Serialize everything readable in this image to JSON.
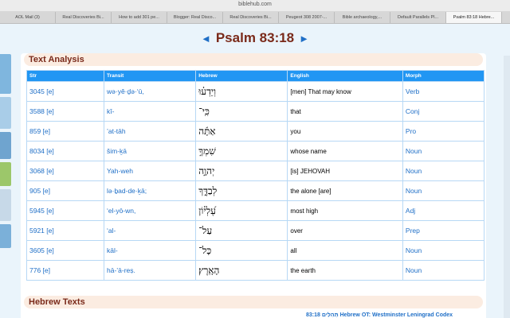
{
  "browser": {
    "url": "biblehub.com",
    "tabs": [
      "AOL Mail (3)",
      "Real Discoveries Bi...",
      "How to add 301 pe...",
      "Blogger: Real Disco...",
      "Real Discoveries Bi...",
      "Peugeot 308 2007-...",
      "Bible archaeology,...",
      "Default Parallels Pl...",
      "Psalm 83:18 Hebre..."
    ]
  },
  "page": {
    "title": "Psalm 83:18",
    "prev_arrow": "◄",
    "next_arrow": "►",
    "text_analysis_heading": "Text Analysis",
    "hebrew_texts_heading": "Hebrew Texts",
    "bottom_link": "83:18 תְּהִלִּים Hebrew OT: Westminster Leningrad Codex"
  },
  "table": {
    "headers": {
      "str": "Str",
      "transit": "Transit",
      "hebrew": "Hebrew",
      "english": "English",
      "morph": "Morph"
    },
    "rows": [
      {
        "str": "3045 [e]",
        "transit": "wə·yê·ḏə·‘ū,",
        "hebrew": "וְיֵדְע֗וּ",
        "english": "[men] That may know",
        "morph": "Verb"
      },
      {
        "str": "3588 [e]",
        "transit": "kî-",
        "hebrew": "כִּֽי־",
        "english": "that",
        "morph": "Conj"
      },
      {
        "str": "859 [e]",
        "transit": "’at-tāh",
        "hebrew": "אַתָּ֬ה",
        "english": "you",
        "morph": "Pro"
      },
      {
        "str": "8034 [e]",
        "transit": "šim-ḵā",
        "hebrew": "שִׁמְךָ֣",
        "english": "whose name",
        "morph": "Noun"
      },
      {
        "str": "3068 [e]",
        "transit": "Yah-weh",
        "hebrew": "יְהוָ֣ה",
        "english": "[is] JEHOVAH",
        "morph": "Noun"
      },
      {
        "str": "905 [e]",
        "transit": "lə·ḇad-de·ḵā;",
        "hebrew": "לְבַדֶּ֑ךָ",
        "english": "the alone [are]",
        "morph": "Noun"
      },
      {
        "str": "5945 [e]",
        "transit": "‘el-yō-wn,",
        "hebrew": "עֶ֝לְי֗וֹן",
        "english": "most high",
        "morph": "Adj"
      },
      {
        "str": "5921 [e]",
        "transit": "‘al-",
        "hebrew": "עַל־",
        "english": "over",
        "morph": "Prep"
      },
      {
        "str": "3605 [e]",
        "transit": "kāl-",
        "hebrew": "כָּל־",
        "english": "all",
        "morph": "Noun"
      },
      {
        "str": "776 [e]",
        "transit": "hā-’ā-reṣ.",
        "hebrew": "הָאָֽרֶץ׃",
        "english": "the earth",
        "morph": "Noun"
      }
    ]
  },
  "colors": {
    "header_blue": "#2196f3",
    "link_blue": "#1f6fc7",
    "title_brown": "#7a2a1a",
    "section_bg": "#fbece1"
  }
}
